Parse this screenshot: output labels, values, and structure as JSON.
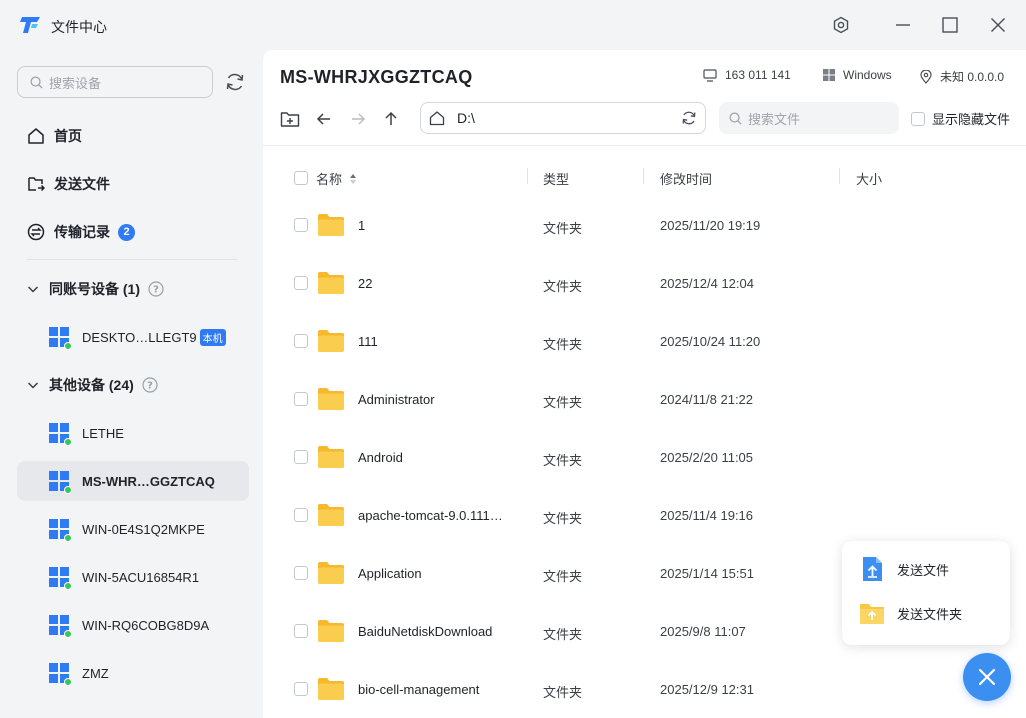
{
  "window": {
    "title": "文件中心"
  },
  "sidebar": {
    "search_placeholder": "搜索设备",
    "nav": [
      {
        "label": "首页",
        "icon": "home-icon"
      },
      {
        "label": "发送文件",
        "icon": "send-file-icon"
      },
      {
        "label": "传输记录",
        "icon": "transfer-icon",
        "badge": "2"
      }
    ],
    "groups": [
      {
        "label": "同账号设备 (1)",
        "devices": [
          {
            "name": "DESKTO…LLEGT9",
            "tag": "本机"
          }
        ]
      },
      {
        "label": "其他设备 (24)",
        "devices": [
          {
            "name": "LETHE"
          },
          {
            "name": "MS-WHR…GGZTCAQ",
            "active": true
          },
          {
            "name": "WIN-0E4S1Q2MKPE"
          },
          {
            "name": "WIN-5ACU16854R1"
          },
          {
            "name": "WIN-RQ6COBG8D9A"
          },
          {
            "name": "ZMZ"
          }
        ]
      }
    ]
  },
  "main": {
    "device_title": "MS-WHRJXGGZTCAQ",
    "device_id": "163 011 141",
    "os": "Windows",
    "location": "未知 0.0.0.0",
    "path": "D:\\",
    "search_placeholder": "搜索文件",
    "show_hidden_label": "显示隐藏文件",
    "columns": {
      "name": "名称",
      "type": "类型",
      "mtime": "修改时间",
      "size": "大小"
    },
    "files": [
      {
        "name": "1",
        "type": "文件夹",
        "mtime": "2025/11/20 19:19"
      },
      {
        "name": "22",
        "type": "文件夹",
        "mtime": "2025/12/4 12:04"
      },
      {
        "name": "111",
        "type": "文件夹",
        "mtime": "2025/10/24 11:20"
      },
      {
        "name": "Administrator",
        "type": "文件夹",
        "mtime": "2024/11/8 21:22"
      },
      {
        "name": "Android",
        "type": "文件夹",
        "mtime": "2025/2/20 11:05"
      },
      {
        "name": "apache-tomcat-9.0.111…",
        "type": "文件夹",
        "mtime": "2025/11/4 19:16"
      },
      {
        "name": "Application",
        "type": "文件夹",
        "mtime": "2025/1/14 15:51"
      },
      {
        "name": "BaiduNetdiskDownload",
        "type": "文件夹",
        "mtime": "2025/9/8 11:07"
      },
      {
        "name": "bio-cell-management",
        "type": "文件夹",
        "mtime": "2025/12/9 12:31"
      }
    ]
  },
  "popup": {
    "send_file": "发送文件",
    "send_folder": "发送文件夹"
  },
  "colors": {
    "accent": "#2f7bf5",
    "folder": "#f8c845",
    "online": "#34c759",
    "fab": "#3b8ff0"
  }
}
